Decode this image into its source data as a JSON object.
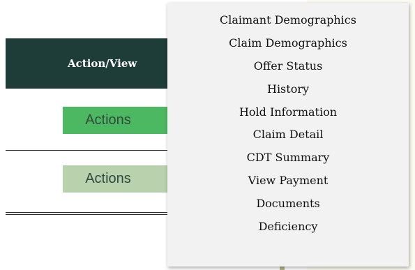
{
  "table": {
    "header_label": "Action/View",
    "rows": [
      {
        "action_label": "Actions"
      },
      {
        "action_label": "Actions"
      }
    ]
  },
  "dropdown": {
    "items": [
      "Claimant Demographics",
      "Claim Demographics",
      "Offer Status",
      "History",
      "Hold Information",
      "Claim Detail",
      "CDT Summary",
      "View Payment",
      "Documents",
      "Deficiency"
    ]
  },
  "colors": {
    "header_bg": "#1f3d38",
    "actions_primary_bg": "#4cb861",
    "actions_secondary_bg": "#b9d1ac",
    "dropdown_bg": "#f2f2f2"
  }
}
